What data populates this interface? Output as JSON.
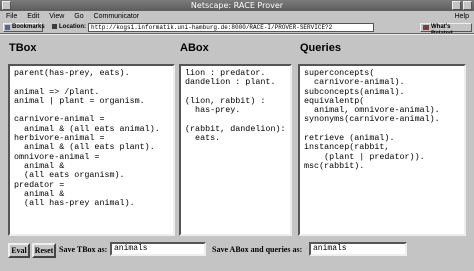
{
  "window": {
    "title": "Netscape: RACE Prover"
  },
  "menu": [
    "File",
    "Edit",
    "View",
    "Go",
    "Communicator"
  ],
  "menu_help": "Help",
  "toolbar": {
    "bookmarks_label": "Bookmarks",
    "location_label": "Location:",
    "location_url": "http://kogs1.informatik.uni-hamburg.de:8000/RACE-I/PROVER-SERVICE?2",
    "whats_related_label": "What's Related"
  },
  "panes": {
    "tbox": {
      "title": "TBox",
      "content": "parent(has-prey, eats).\n\nanimal => /plant.\nanimal | plant = organism.\n\ncarnivore-animal =\n  animal & (all eats animal).\nherbivore-animal =\n  animal & (all eats plant).\nomnivore-animal =\n  animal &\n  (all eats organism).\npredator =\n  animal &\n  (all has-prey animal)."
    },
    "abox": {
      "title": "ABox",
      "content": "lion : predator.\ndandelion : plant.\n\n(lion, rabbit) :\n  has-prey.\n\n(rabbit, dandelion):\n  eats."
    },
    "queries": {
      "title": "Queries",
      "content": "superconcepts(\n  carnivore-animal).\nsubconcepts(animal).\nequivalentp(\n  animal, omnivore-animal).\nsynonyms(carnivore-animal).\n\nretrieve (animal).\ninstancep(rabbit,\n    (plant | predator)).\nmsc(rabbit)."
    }
  },
  "bottom": {
    "eval_label": "Eval",
    "reset_label": "Reset",
    "save_tbox_label": "Save TBox as:",
    "save_tbox_value": "animals",
    "save_abox_label": "Save ABox and queries as:",
    "save_abox_value": "animals"
  }
}
